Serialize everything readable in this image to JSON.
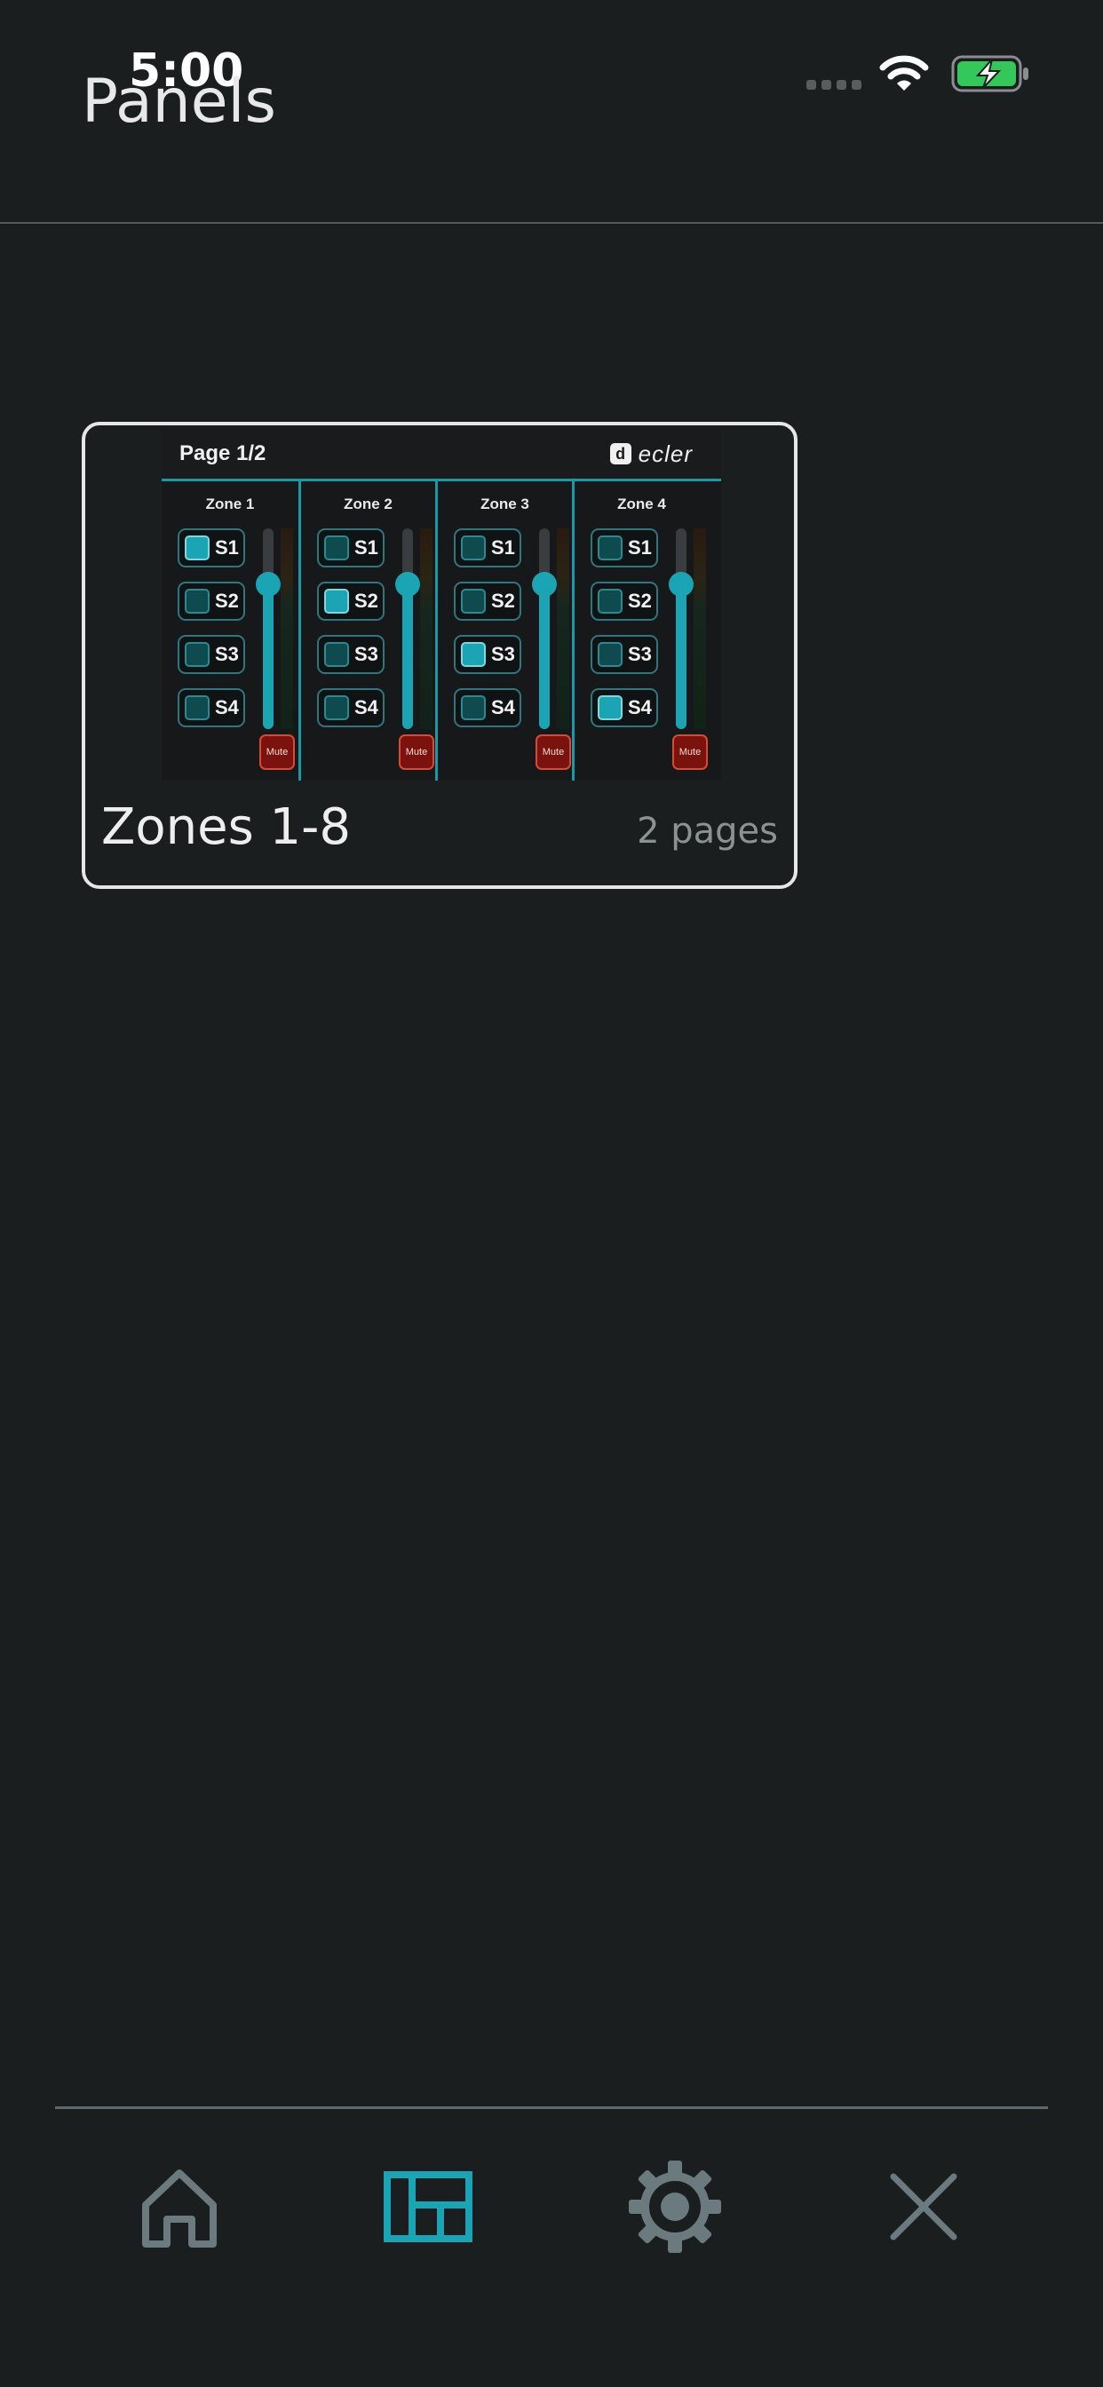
{
  "status_bar": {
    "time": "5:00"
  },
  "header": {
    "title": "Panels"
  },
  "panels": [
    {
      "name": "Zones 1-8",
      "pages": "2 pages",
      "thumbnail": {
        "page_label": "Page 1/2",
        "logo_badge": "d",
        "logo_text": "ecler",
        "mute_label": "Mute",
        "zones": [
          {
            "name": "Zone 1",
            "sources": [
              "S1",
              "S2",
              "S3",
              "S4"
            ],
            "active_source": "S1",
            "level": 0.72
          },
          {
            "name": "Zone 2",
            "sources": [
              "S1",
              "S2",
              "S3",
              "S4"
            ],
            "active_source": "S2",
            "level": 0.72
          },
          {
            "name": "Zone 3",
            "sources": [
              "S1",
              "S2",
              "S3",
              "S4"
            ],
            "active_source": "S3",
            "level": 0.72
          },
          {
            "name": "Zone 4",
            "sources": [
              "S1",
              "S2",
              "S3",
              "S4"
            ],
            "active_source": "S4",
            "level": 0.72
          }
        ]
      }
    }
  ],
  "tab_bar": {
    "items": [
      {
        "icon": "home-icon",
        "active": false
      },
      {
        "icon": "panels-icon",
        "active": true
      },
      {
        "icon": "gear-icon",
        "active": false
      },
      {
        "icon": "close-icon",
        "active": false
      }
    ]
  },
  "colors": {
    "background": "#1b1e1f",
    "accent": "#1ba4b4",
    "inactive_icon": "#6b7a7e",
    "mute": "#7a130d"
  }
}
